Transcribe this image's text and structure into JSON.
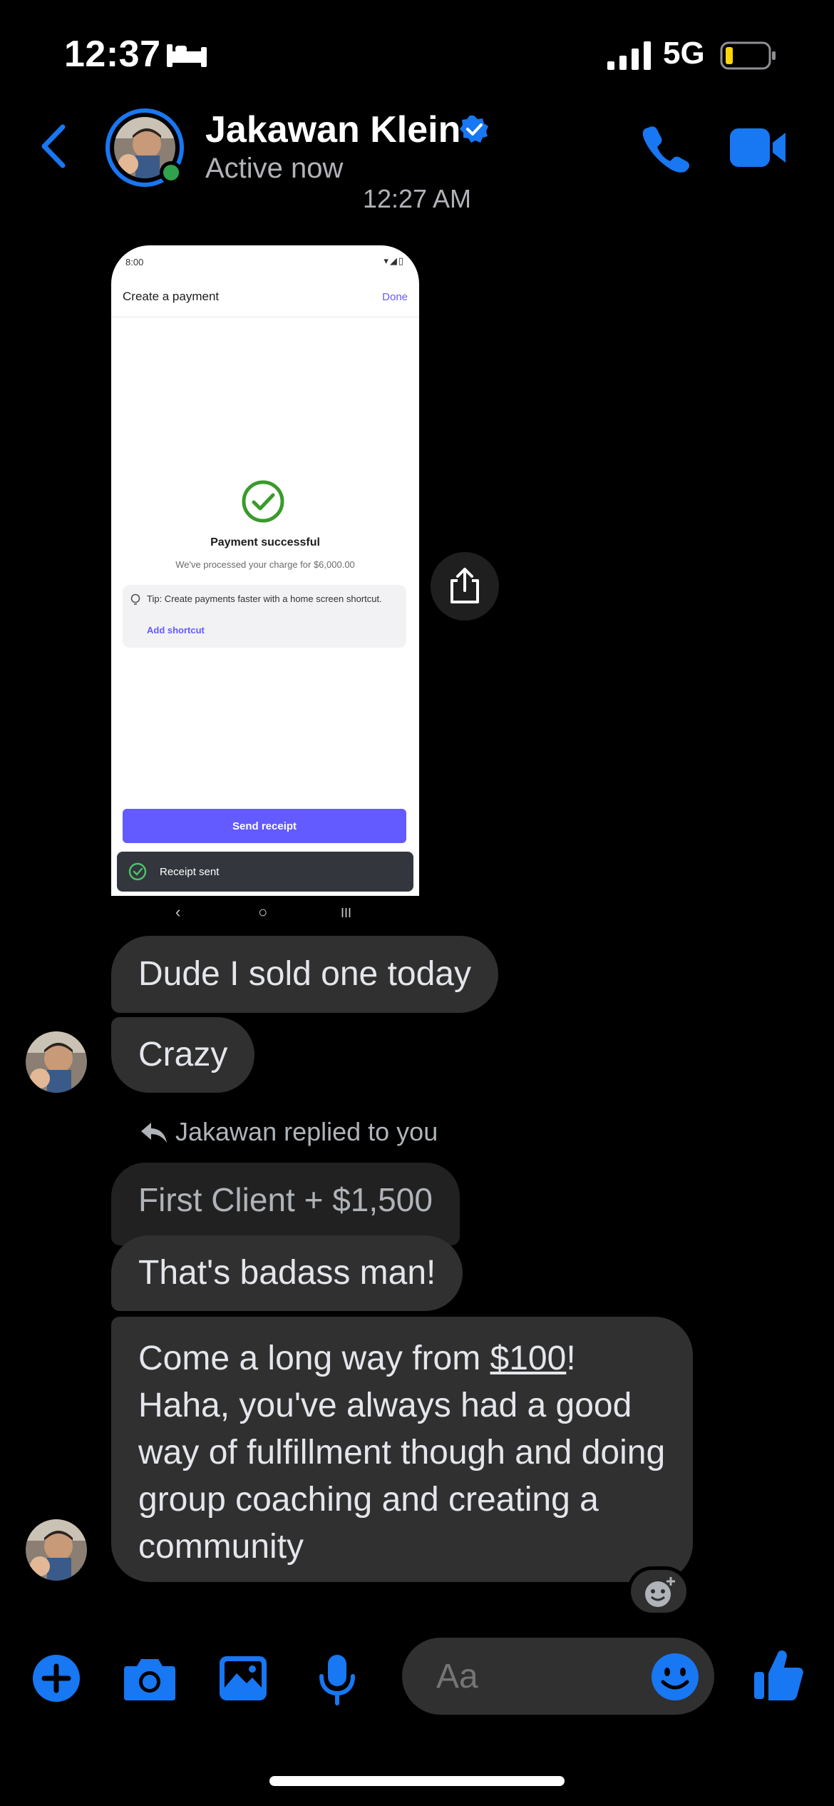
{
  "status": {
    "time": "12:37",
    "network": "5G"
  },
  "header": {
    "name": "Jakawan Klein",
    "presence": "Active now"
  },
  "timestamp": "12:27 AM",
  "screenshot": {
    "status_time": "8:00",
    "title": "Create a payment",
    "done": "Done",
    "pay_title": "Payment successful",
    "pay_sub": "We've processed your charge for $6,000.00",
    "tip_text": "Tip: Create payments faster with a home screen shortcut.",
    "tip_link": "Add shortcut",
    "send_btn": "Send receipt",
    "toast": "Receipt sent"
  },
  "messages": {
    "m1": "Dude I sold one today",
    "m2": "Crazy",
    "reply_label": "Jakawan replied to you",
    "quoted": "First Client + $1,500",
    "m3": "That's badass man!",
    "m4_pre": "Come a long way from ",
    "m4_link": "$100",
    "m4_post": "! Haha, you've always had a good way of fulfillment though and doing group coaching and creating a community"
  },
  "composer": {
    "placeholder": "Aa"
  },
  "colors": {
    "accent": "#1877f2",
    "bubble": "#303030",
    "stripe": "#635bff",
    "online": "#31a24c"
  }
}
